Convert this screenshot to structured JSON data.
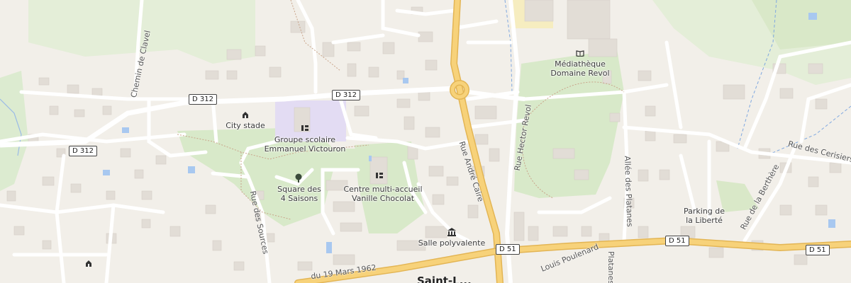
{
  "places": {
    "mediatheque": "Médiathèque\nDomaine Revol",
    "city_stade": "City stade",
    "groupe_scolaire": "Groupe scolaire\nEmmanuel Victouron",
    "square": "Square des\n4 Saisons",
    "centre": "Centre multi-accueil\nVanille Chocolat",
    "salle": "Salle polyvalente",
    "parking": "Parking de\nla Liberté",
    "town_partial": "Saint-L..."
  },
  "streets": {
    "chemin_clavel": "Chemin de Clavel",
    "rue_andre_caire": "Rue André Caire",
    "rue_hector_revol": "Rue Hector Revol",
    "allee_platanes": "Allée des Platanes",
    "rue_berthere": "Rue de la Berthère",
    "rue_cerisiers": "Rue des Cerisiers",
    "rue_sources": "Rue des Sources",
    "rue_19_mars": "du 19 Mars 1962",
    "louis_poulenard": "Louis Poulenard",
    "platanes_fragment": "Platanes"
  },
  "route_shields": {
    "d312_a": "D 312",
    "d312_b": "D 312",
    "d312_c": "D 312",
    "d51_a": "D 51",
    "d51_b": "D 51",
    "d51_c": "D 51"
  },
  "icons": {
    "mediatheque": "library-icon",
    "city_stade": "sports-pitch-icon",
    "groupe_scolaire": "school-icon",
    "square": "park-tree-icon",
    "centre": "childcare-icon",
    "salle": "townhall-icon",
    "left_poi": "sports-pitch-icon"
  },
  "colors": {
    "background": "#f2efe9",
    "park": "#d8e9c9",
    "school": "#e3dcf3",
    "road_primary": "#f7d27a",
    "road_casing": "#e3b554",
    "building": "#e2ddd6",
    "water": "#a8c8f0"
  }
}
